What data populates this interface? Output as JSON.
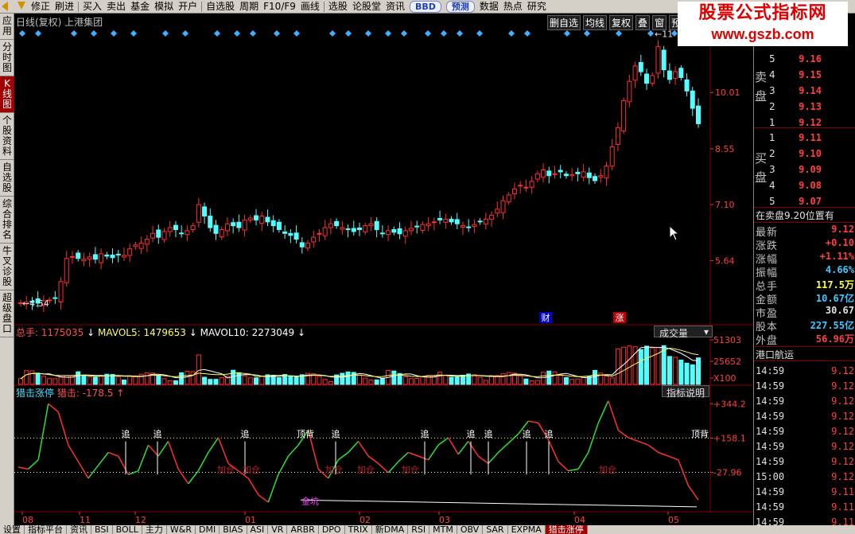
{
  "toolbar": {
    "items": [
      "修正",
      "刷进",
      "买入",
      "卖出",
      "基金",
      "模拟",
      "开户",
      "自选股",
      "周期",
      "F10/F9",
      "画线",
      "选股",
      "论股堂",
      "资讯"
    ],
    "bbd_label": "BBD",
    "predict_label": "预测",
    "right_items": [
      "数据",
      "热点",
      "研究"
    ]
  },
  "left_tabs": [
    "应用",
    "分时图",
    "K线图",
    "个股资料",
    "自选股",
    "综合排名",
    "牛叉诊股",
    "超级盘口"
  ],
  "chart_header": {
    "title": "日线(复权) 上港集团",
    "buttons": [
      "删自选",
      "均线",
      "复权",
      "叠",
      "窗",
      "预测"
    ]
  },
  "watermark": {
    "line1": "股票公式指标网",
    "line2": "www.gszb.com"
  },
  "chart_data": [
    {
      "type": "candlestick",
      "title": "日线(复权) 上港集团",
      "y_axis_labels": [
        "10.01",
        "8.55",
        "7.10",
        "5.64"
      ],
      "ylim": [
        4.0,
        11.4
      ],
      "x_axis_labels": [
        "08",
        "11",
        "12",
        "01",
        "02",
        "03",
        "04",
        "05"
      ],
      "annotations": {
        "low": "4.54",
        "high": "11",
        "tags": [
          "财",
          "涨"
        ]
      },
      "ohlc_close_series": [
        4.55,
        4.56,
        4.56,
        4.54,
        4.6,
        4.62,
        4.66,
        5.1,
        5.7,
        5.75,
        5.7,
        5.68,
        5.74,
        5.68,
        5.82,
        5.76,
        5.72,
        5.8,
        5.78,
        5.95,
        6.05,
        6.1,
        6.2,
        6.35,
        6.25,
        6.4,
        6.5,
        6.45,
        6.35,
        6.42,
        6.55,
        7.1,
        6.8,
        6.5,
        6.35,
        6.45,
        6.6,
        6.55,
        6.5,
        6.7,
        6.75,
        6.7,
        6.8,
        6.65,
        6.55,
        6.45,
        6.35,
        6.3,
        6.2,
        6.0,
        6.1,
        6.25,
        6.35,
        6.5,
        6.6,
        6.55,
        6.5,
        6.45,
        6.4,
        6.45,
        6.55,
        6.6,
        6.45,
        6.35,
        6.42,
        6.38,
        6.34,
        6.42,
        6.48,
        6.52,
        6.58,
        6.6,
        6.65,
        6.7,
        6.72,
        6.65,
        6.6,
        6.55,
        6.5,
        6.58,
        6.65,
        6.72,
        6.82,
        6.98,
        7.2,
        7.35,
        7.5,
        7.6,
        7.55,
        7.7,
        7.9,
        8.0,
        7.85,
        7.9,
        7.95,
        7.85,
        7.88,
        7.9,
        7.95,
        7.8,
        7.72,
        7.85,
        8.1,
        8.6,
        9.1,
        9.8,
        10.3,
        10.7,
        10.55,
        10.25,
        10.45,
        11.2,
        10.6,
        10.35,
        10.55,
        10.4,
        10.05,
        9.6,
        9.2
      ],
      "volume_panel": {
        "title": "总手: 1175035",
        "mavol5": "MAVOL5: 1479653",
        "mavol10": "MAVOL10: 2273049",
        "indicator_button": "成交量",
        "y_labels": [
          "51303",
          "25652",
          "X100"
        ]
      },
      "indicator_panel": {
        "title": "猎击涨停",
        "value_label": "猎击: -178.5",
        "explain_button": "指标说明",
        "y_labels": [
          "+344.2",
          "+158.1",
          "-27.96"
        ],
        "markers": {
          "zhui": [
            "追",
            "追",
            "追",
            "追",
            "追",
            "追",
            "追",
            "追",
            "追",
            "追"
          ],
          "dingbei": [
            "顶背",
            "顶背"
          ],
          "jiacang": [
            "加仓",
            "加仓",
            "加仓",
            "加仓",
            "加仓",
            "加仓"
          ],
          "jinkang": "金坑"
        }
      }
    }
  ],
  "quote": {
    "sell_label": "卖盘",
    "buy_label": "买盘",
    "sell": [
      {
        "level": "5",
        "price": "9.16"
      },
      {
        "level": "4",
        "price": "9.15"
      },
      {
        "level": "3",
        "price": "9.14"
      },
      {
        "level": "2",
        "price": "9.13"
      },
      {
        "level": "1",
        "price": "9.12"
      }
    ],
    "buy": [
      {
        "level": "1",
        "price": "9.11"
      },
      {
        "level": "2",
        "price": "9.10"
      },
      {
        "level": "3",
        "price": "9.09"
      },
      {
        "level": "4",
        "price": "9.08"
      },
      {
        "level": "5",
        "price": "9.07"
      }
    ],
    "position_note": "在卖盘9.20位置有",
    "stats": [
      {
        "k": "最新",
        "v": "9.12",
        "color": "#ff4040"
      },
      {
        "k": "涨跌",
        "v": "+0.10",
        "color": "#ff4040"
      },
      {
        "k": "涨幅",
        "v": "+1.11%",
        "color": "#ff4040"
      },
      {
        "k": "振幅",
        "v": "4.66%",
        "color": "#40c8ff"
      },
      {
        "k": "总手",
        "v": "117.5万",
        "color": "#ffff40"
      },
      {
        "k": "金额",
        "v": "10.67亿",
        "color": "#40c8ff"
      },
      {
        "k": "市盈",
        "v": "30.67",
        "color": "#e0e0e0"
      },
      {
        "k": "股本",
        "v": "227.55亿",
        "color": "#40c8ff"
      },
      {
        "k": "外盘",
        "v": "56.96万",
        "color": "#ff4040"
      }
    ],
    "section_title": "港口航运",
    "ticks": [
      {
        "t": "14:59",
        "p": "9.12"
      },
      {
        "t": "14:59",
        "p": "9.12"
      },
      {
        "t": "14:59",
        "p": "9.12"
      },
      {
        "t": "14:59",
        "p": "9.12"
      },
      {
        "t": "14:59",
        "p": "9.12"
      },
      {
        "t": "14:59",
        "p": "9.12"
      },
      {
        "t": "14:59",
        "p": "9.12"
      },
      {
        "t": "15:00",
        "p": "9.12"
      },
      {
        "t": "14:59",
        "p": "9.11"
      },
      {
        "t": "14:59",
        "p": "9.11"
      },
      {
        "t": "14:59",
        "p": "9.11"
      }
    ]
  },
  "bottom_tabs": [
    "设置",
    "指标平台",
    "资讯",
    "BSI",
    "BOLL",
    "主力",
    "W&R",
    "DMI",
    "BIAS",
    "ASI",
    "VR",
    "ARBR",
    "DPO",
    "TRIX",
    "新DMA",
    "RSI",
    "MTM",
    "OBV",
    "SAR",
    "EXPMA",
    "猎击涨停"
  ],
  "bottom_tab_active": "猎击涨停",
  "colors": {
    "up": "#ff3030",
    "down": "#54ffff",
    "bg": "#000000",
    "grid": "#800000"
  }
}
